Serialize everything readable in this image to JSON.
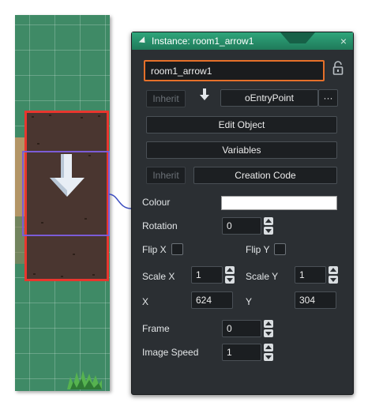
{
  "room": {
    "grass_color": "#3f8a66",
    "dirt_color": "#4a3630",
    "selection_color": "#e8362e"
  },
  "panel": {
    "title": "Instance: room1_arrow1",
    "close_glyph": "×",
    "accent_color": "#2fa67b",
    "name_value": "room1_arrow1",
    "inherit_label": "Inherit",
    "object_name": "oEntryPoint",
    "more_label": "···",
    "edit_object_label": "Edit Object",
    "variables_label": "Variables",
    "inherit2_label": "Inherit",
    "creation_code_label": "Creation Code",
    "colour_label": "Colour",
    "colour_value": "#ffffff",
    "rotation_label": "Rotation",
    "rotation_value": "0",
    "flipx_label": "Flip X",
    "flipy_label": "Flip Y",
    "scalex_label": "Scale X",
    "scalex_value": "1",
    "scaley_label": "Scale Y",
    "scaley_value": "1",
    "x_label": "X",
    "x_value": "624",
    "y_label": "Y",
    "y_value": "304",
    "frame_label": "Frame",
    "frame_value": "0",
    "imagespeed_label": "Image Speed",
    "imagespeed_value": "1"
  }
}
